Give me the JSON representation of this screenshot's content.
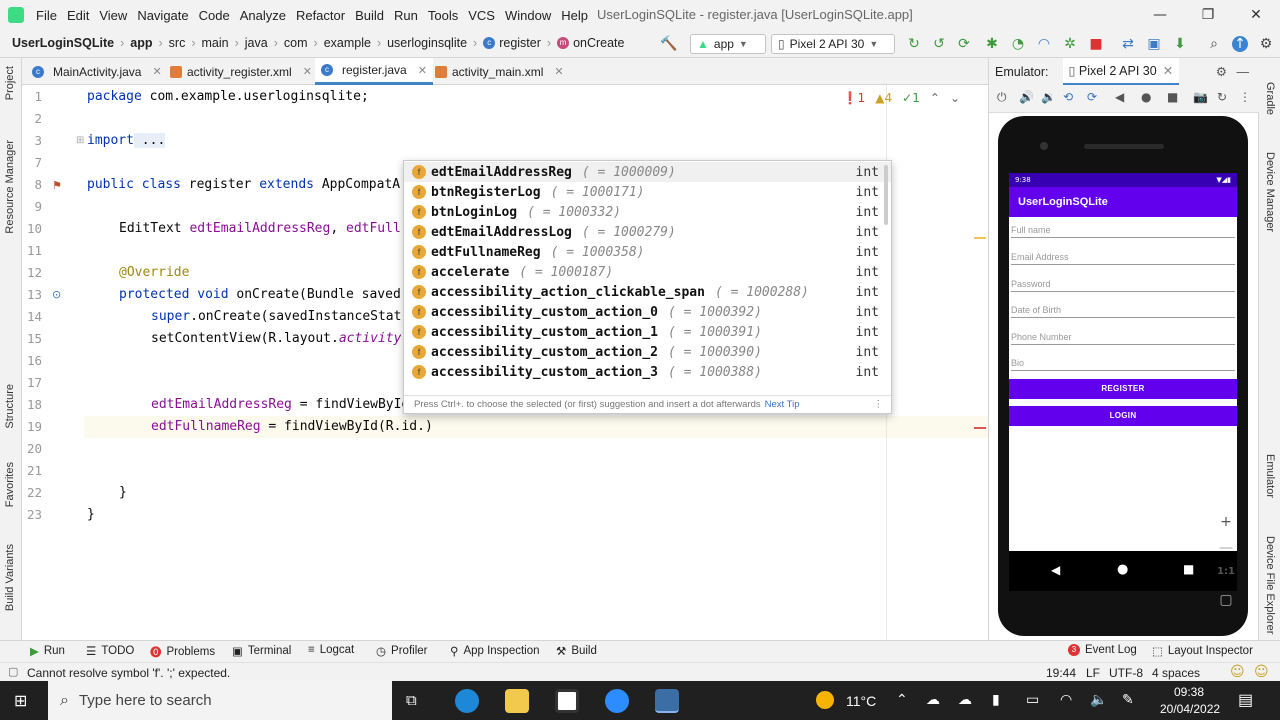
{
  "window": {
    "menus": [
      "File",
      "Edit",
      "View",
      "Navigate",
      "Code",
      "Analyze",
      "Refactor",
      "Build",
      "Run",
      "Tools",
      "VCS",
      "Window",
      "Help"
    ],
    "title": "UserLoginSQLite - register.java [UserLoginSQLite.app]",
    "controls": [
      "—",
      "❐",
      "✕"
    ]
  },
  "breadcrumb": {
    "items": [
      "UserLoginSQLite",
      "app",
      "src",
      "main",
      "java",
      "com",
      "example",
      "userloginsqlite",
      "register",
      "onCreate"
    ]
  },
  "toolbar": {
    "run_config": "app",
    "device": "Pixel 2 API 30"
  },
  "tabs": [
    {
      "label": "MainActivity.java"
    },
    {
      "label": "activity_register.xml"
    },
    {
      "label": "register.java"
    },
    {
      "label": "activity_main.xml"
    }
  ],
  "left_tools": [
    "Project",
    "Resource Manager",
    "Structure",
    "Favorites",
    "Build Variants"
  ],
  "right_tools": [
    "Gradle",
    "Device Manager",
    "Emulator",
    "Device File Explorer"
  ],
  "inspections": {
    "errors": "1",
    "warnings": "4",
    "weak": "1"
  },
  "code": {
    "line_numbers": [
      "1",
      "2",
      "3",
      "7",
      "8",
      "9",
      "10",
      "11",
      "12",
      "13",
      "14",
      "15",
      "16",
      "17",
      "18",
      "19",
      "20",
      "21",
      "22",
      "23"
    ],
    "l1_kw": "package",
    "l1_rest": " com.example.userloginsqlite;",
    "l3_kw": "import",
    "l3_rest": " ...",
    "l8_kw": "public class",
    "l8_name": " register ",
    "l8_kw2": "extends",
    "l8_rest": " AppCompatA",
    "l10_type": "EditText ",
    "l10_f1": "edtEmailAddressReg",
    "l10_sep": ", ",
    "l10_f2": "edtFull",
    "l12_ann": "@Override",
    "l13_kw": "protected void",
    "l13_rest": " onCreate(Bundle saved",
    "l14_kw": "super",
    "l14_rest": ".onCreate(savedInstanceStat",
    "l15_a": "setContentView(R.layout.",
    "l15_b": "activity",
    "l18_f": "edtEmailAddressReg",
    "l18_rest": " = findViewById",
    "l19_f": "edtFullnameReg",
    "l19_rest": " = findViewById(R.id.)",
    "l22": "}",
    "l23": "}"
  },
  "completion": {
    "items": [
      {
        "name": "edtEmailAddressReg",
        "value": "( = 1000009)",
        "type": "int"
      },
      {
        "name": "btnRegisterLog",
        "value": "( = 1000171)",
        "type": "int"
      },
      {
        "name": "btnLoginLog",
        "value": "( = 1000332)",
        "type": "int"
      },
      {
        "name": "edtEmailAddressLog",
        "value": "( = 1000279)",
        "type": "int"
      },
      {
        "name": "edtFullnameReg",
        "value": "( = 1000358)",
        "type": "int"
      },
      {
        "name": "accelerate",
        "value": "( = 1000187)",
        "type": "int"
      },
      {
        "name": "accessibility_action_clickable_span",
        "value": "( = 1000288)",
        "type": "int"
      },
      {
        "name": "accessibility_custom_action_0",
        "value": "( = 1000392)",
        "type": "int"
      },
      {
        "name": "accessibility_custom_action_1",
        "value": "( = 1000391)",
        "type": "int"
      },
      {
        "name": "accessibility_custom_action_2",
        "value": "( = 1000390)",
        "type": "int"
      },
      {
        "name": "accessibility_custom_action_3",
        "value": "( = 1000388)",
        "type": "int"
      }
    ],
    "footer": "Press Ctrl+. to choose the selected (or first) suggestion and insert a dot afterwards",
    "next_tip": "Next Tip"
  },
  "emulator": {
    "label": "Emulator:",
    "device_tab": "Pixel 2 API 30",
    "status_time": "9:38",
    "app_title": "UserLoginSQLite",
    "fields": [
      "Full name",
      "Email Address",
      "Password",
      "Date of Birth",
      "Phone Number",
      "Bio"
    ],
    "register_btn": "REGISTER",
    "login_btn": "LOGIN",
    "side_zoom_label": "1:1"
  },
  "bottom_tools": [
    "Run",
    "TODO",
    "Problems",
    "Terminal",
    "Logcat",
    "Profiler",
    "App Inspection",
    "Build"
  ],
  "bottom_right": {
    "event_log": "Event Log",
    "event_count": "3",
    "layout_inspector": "Layout Inspector"
  },
  "status": {
    "message": "Cannot resolve symbol 'f'. ';' expected.",
    "position": "19:44",
    "line_sep": "LF",
    "encoding": "UTF-8",
    "indent": "4 spaces"
  },
  "taskbar": {
    "search_placeholder": "Type here to search",
    "weather": "11°C",
    "time": "09:38",
    "date": "20/04/2022"
  },
  "colors": {
    "accent": "#4083c9",
    "app_purple": "#6200ee",
    "status_purple": "#3700b3"
  }
}
